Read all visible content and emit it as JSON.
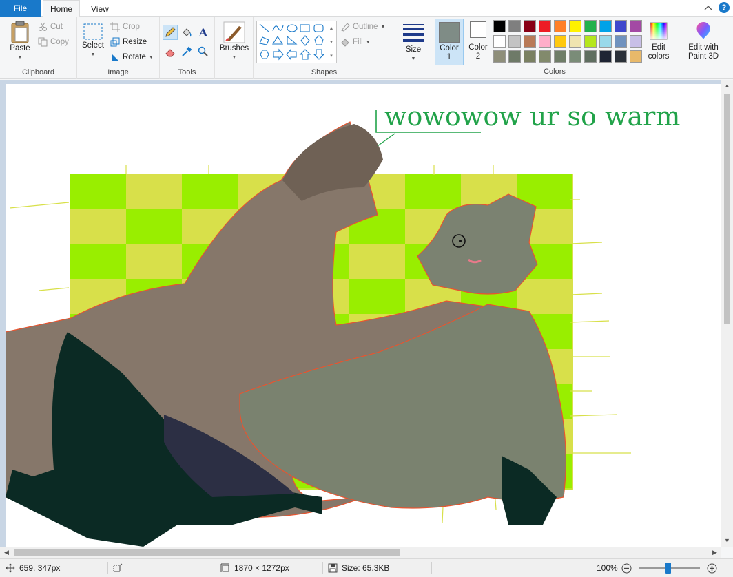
{
  "tabs": {
    "file": "File",
    "home": "Home",
    "view": "View"
  },
  "window": {
    "help": "?"
  },
  "clipboard": {
    "paste": "Paste",
    "cut": "Cut",
    "copy": "Copy",
    "label": "Clipboard"
  },
  "image": {
    "select": "Select",
    "crop": "Crop",
    "resize": "Resize",
    "rotate": "Rotate",
    "label": "Image"
  },
  "tools": {
    "label": "Tools",
    "text_glyph": "A"
  },
  "brushes": {
    "label": "Brushes"
  },
  "shapes": {
    "outline": "Outline",
    "fill": "Fill",
    "label": "Shapes"
  },
  "size": {
    "label": "Size"
  },
  "colors": {
    "color1_label": "Color\n1",
    "color2_label": "Color\n2",
    "edit_colors": "Edit\ncolors",
    "edit_paint3d": "Edit with\nPaint 3D",
    "label": "Colors",
    "color1": "#7f8c86",
    "color2": "#ffffff",
    "palette_row1": [
      "#000000",
      "#7f7f7f",
      "#880015",
      "#ed1c24",
      "#ff7f27",
      "#fff200",
      "#22b14c",
      "#00a2e8",
      "#3f48cc",
      "#a349a4"
    ],
    "palette_row2": [
      "#ffffff",
      "#c3c3c3",
      "#b97a57",
      "#ffaec9",
      "#ffc90e",
      "#efe4b0",
      "#b5e61d",
      "#99d9ea",
      "#7092be",
      "#c8bfe7"
    ],
    "palette_row3": [
      "#8e8e7a",
      "#6e7a68",
      "#7a8062",
      "#828a6c",
      "#6f7d68",
      "#7a8c78",
      "#5f6e60",
      "#1e2433",
      "#2a3038",
      "#e8b96a"
    ]
  },
  "canvas": {
    "caption": "wowowow ur so warm",
    "caption_color": "#22a34a",
    "bg_yellow": "#d8e04a",
    "bg_green": "#99ee00"
  },
  "status": {
    "cursor": "659, 347px",
    "dimensions": "1870 × 1272px",
    "size": "Size: 65.3KB",
    "zoom": "100%"
  }
}
